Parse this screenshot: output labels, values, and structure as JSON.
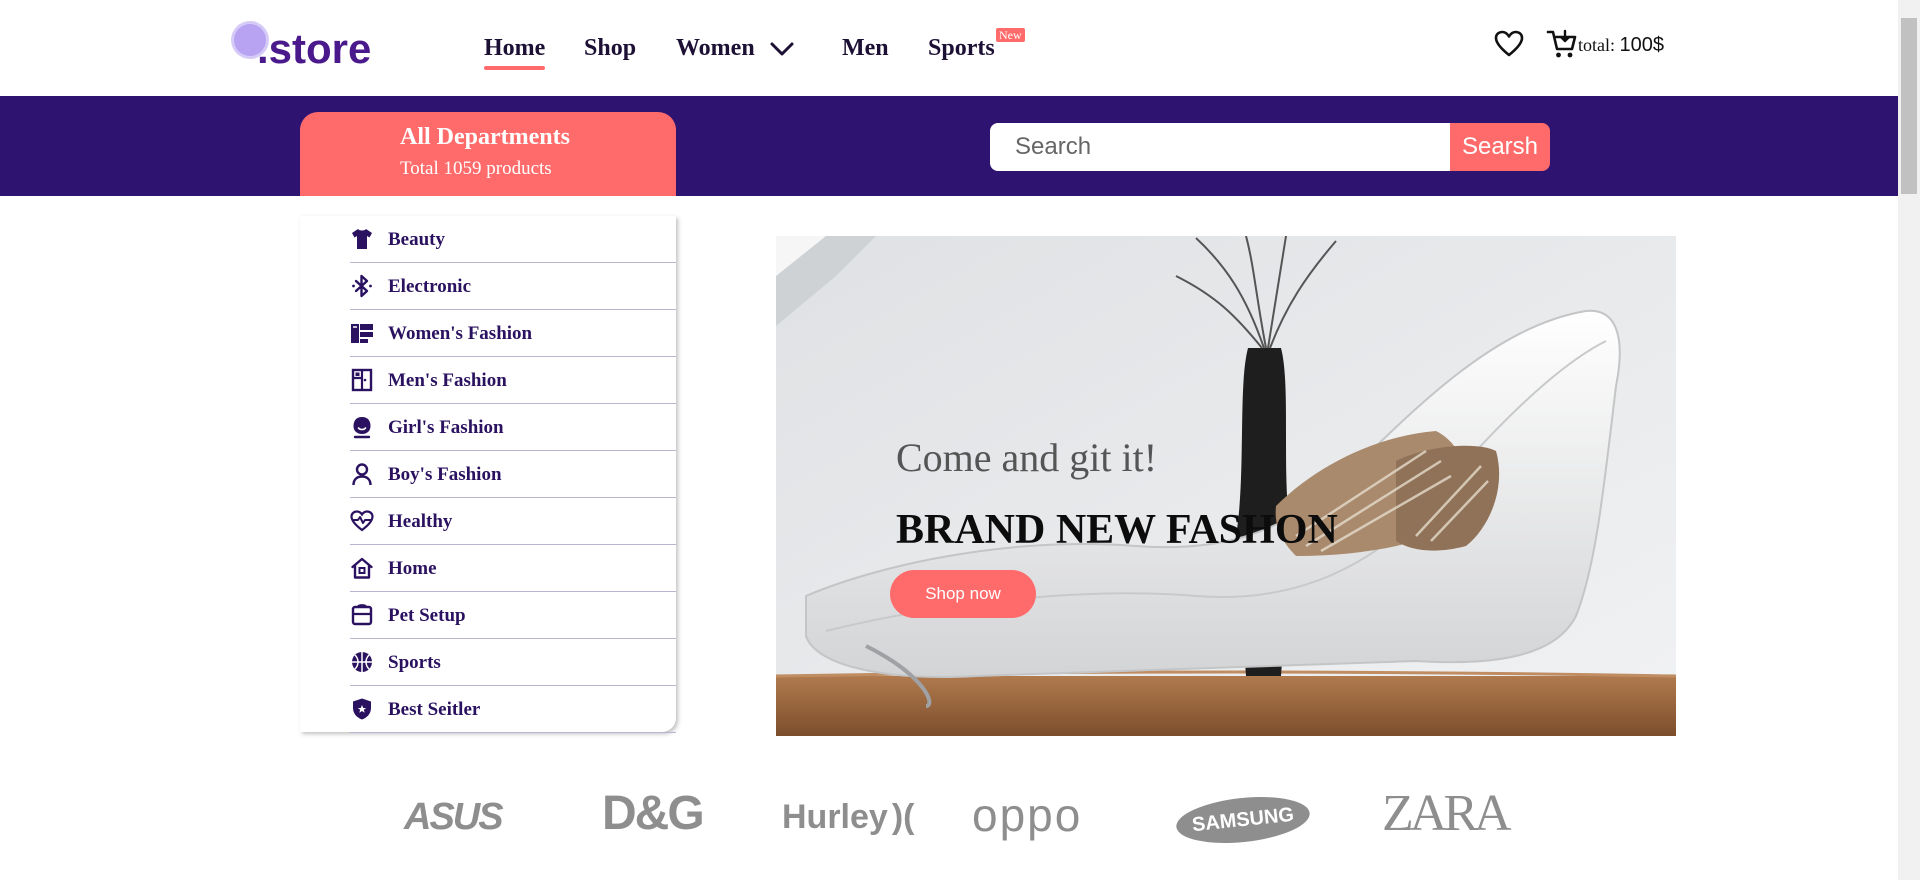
{
  "header": {
    "logo_text": ".store",
    "nav": [
      {
        "label": "Home",
        "active": true
      },
      {
        "label": "Shop"
      },
      {
        "label": "Women",
        "has_dropdown": true
      },
      {
        "label": "Men"
      },
      {
        "label": "Sports",
        "badge": "New"
      }
    ],
    "cart": {
      "total_label": "total:",
      "total_value": "100$"
    }
  },
  "departments": {
    "title": "All Departments",
    "subtitle": "Total 1059 products"
  },
  "search": {
    "placeholder": "Search",
    "button_label": "Searsh"
  },
  "categories": [
    {
      "label": "Beauty",
      "icon": "tshirt-icon"
    },
    {
      "label": "Electronic",
      "icon": "bluetooth-icon"
    },
    {
      "label": "Women's Fashion",
      "icon": "shirt-icon"
    },
    {
      "label": "Men's Fashion",
      "icon": "wardrobe-icon"
    },
    {
      "label": "Girl's Fashion",
      "icon": "user-hair-icon"
    },
    {
      "label": "Boy's Fashion",
      "icon": "user-icon"
    },
    {
      "label": "Healthy",
      "icon": "heart-pulse-icon"
    },
    {
      "label": "Home",
      "icon": "house-icon"
    },
    {
      "label": "Pet Setup",
      "icon": "pet-box-icon"
    },
    {
      "label": "Sports",
      "icon": "basketball-icon"
    },
    {
      "label": "Best Seitler",
      "icon": "shield-star-icon"
    }
  ],
  "hero": {
    "subtitle": "Come and git it!",
    "title": "BRAND NEW FASHON",
    "button_label": "Shop now"
  },
  "brands": [
    "ASUS",
    "D&G",
    "Hurley",
    "oppo",
    "SAMSUNG",
    "ZARA"
  ],
  "colors": {
    "brand_purple": "#2e1470",
    "accent_coral": "#ff6b6b",
    "logo_purple": "#4a1a8c"
  }
}
